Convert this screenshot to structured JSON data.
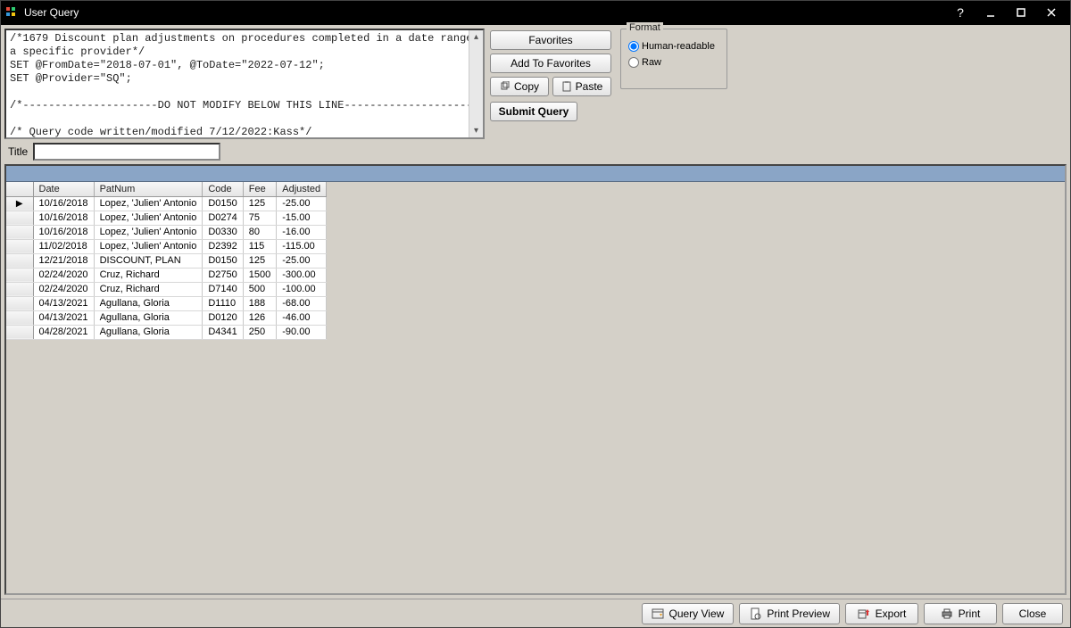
{
  "window": {
    "title": "User Query"
  },
  "sql": {
    "text": "/*1679 Discount plan adjustments on procedures completed in a date range by\na specific provider*/\nSET @FromDate=\"2018-07-01\", @ToDate=\"2022-07-12\";\nSET @Provider=\"SQ\";\n\n/*---------------------DO NOT MODIFY BELOW THIS LINE---------------------*/\n\n/* Query code written/modified 7/12/2022:Kass*/\n/*"
  },
  "buttons": {
    "favorites": "Favorites",
    "add_to_favorites": "Add To Favorites",
    "copy": "Copy",
    "paste": "Paste",
    "submit": "Submit Query"
  },
  "format": {
    "legend": "Format",
    "human": "Human-readable",
    "raw": "Raw",
    "selected": "human"
  },
  "titleRow": {
    "label": "Title",
    "value": ""
  },
  "grid": {
    "columns": [
      "",
      "Date",
      "PatNum",
      "Code",
      "Fee",
      "Adjusted"
    ],
    "rows": [
      {
        "ptr": true,
        "date": "10/16/2018",
        "pat": "Lopez, 'Julien' Antonio",
        "code": "D0150",
        "fee": "125",
        "adj": "-25.00"
      },
      {
        "ptr": false,
        "date": "10/16/2018",
        "pat": "Lopez, 'Julien' Antonio",
        "code": "D0274",
        "fee": "75",
        "adj": "-15.00"
      },
      {
        "ptr": false,
        "date": "10/16/2018",
        "pat": "Lopez, 'Julien' Antonio",
        "code": "D0330",
        "fee": "80",
        "adj": "-16.00"
      },
      {
        "ptr": false,
        "date": "11/02/2018",
        "pat": "Lopez, 'Julien' Antonio",
        "code": "D2392",
        "fee": "115",
        "adj": "-115.00"
      },
      {
        "ptr": false,
        "date": "12/21/2018",
        "pat": "DISCOUNT, PLAN",
        "code": "D0150",
        "fee": "125",
        "adj": "-25.00"
      },
      {
        "ptr": false,
        "date": "02/24/2020",
        "pat": "Cruz, Richard",
        "code": "D2750",
        "fee": "1500",
        "adj": "-300.00"
      },
      {
        "ptr": false,
        "date": "02/24/2020",
        "pat": "Cruz, Richard",
        "code": "D7140",
        "fee": "500",
        "adj": "-100.00"
      },
      {
        "ptr": false,
        "date": "04/13/2021",
        "pat": "Agullana, Gloria",
        "code": "D1110",
        "fee": "188",
        "adj": "-68.00"
      },
      {
        "ptr": false,
        "date": "04/13/2021",
        "pat": "Agullana, Gloria",
        "code": "D0120",
        "fee": "126",
        "adj": "-46.00"
      },
      {
        "ptr": false,
        "date": "04/28/2021",
        "pat": "Agullana, Gloria",
        "code": "D4341",
        "fee": "250",
        "adj": "-90.00"
      }
    ]
  },
  "footer": {
    "query_view": "Query View",
    "print_preview": "Print Preview",
    "export": "Export",
    "print": "Print",
    "close": "Close"
  }
}
